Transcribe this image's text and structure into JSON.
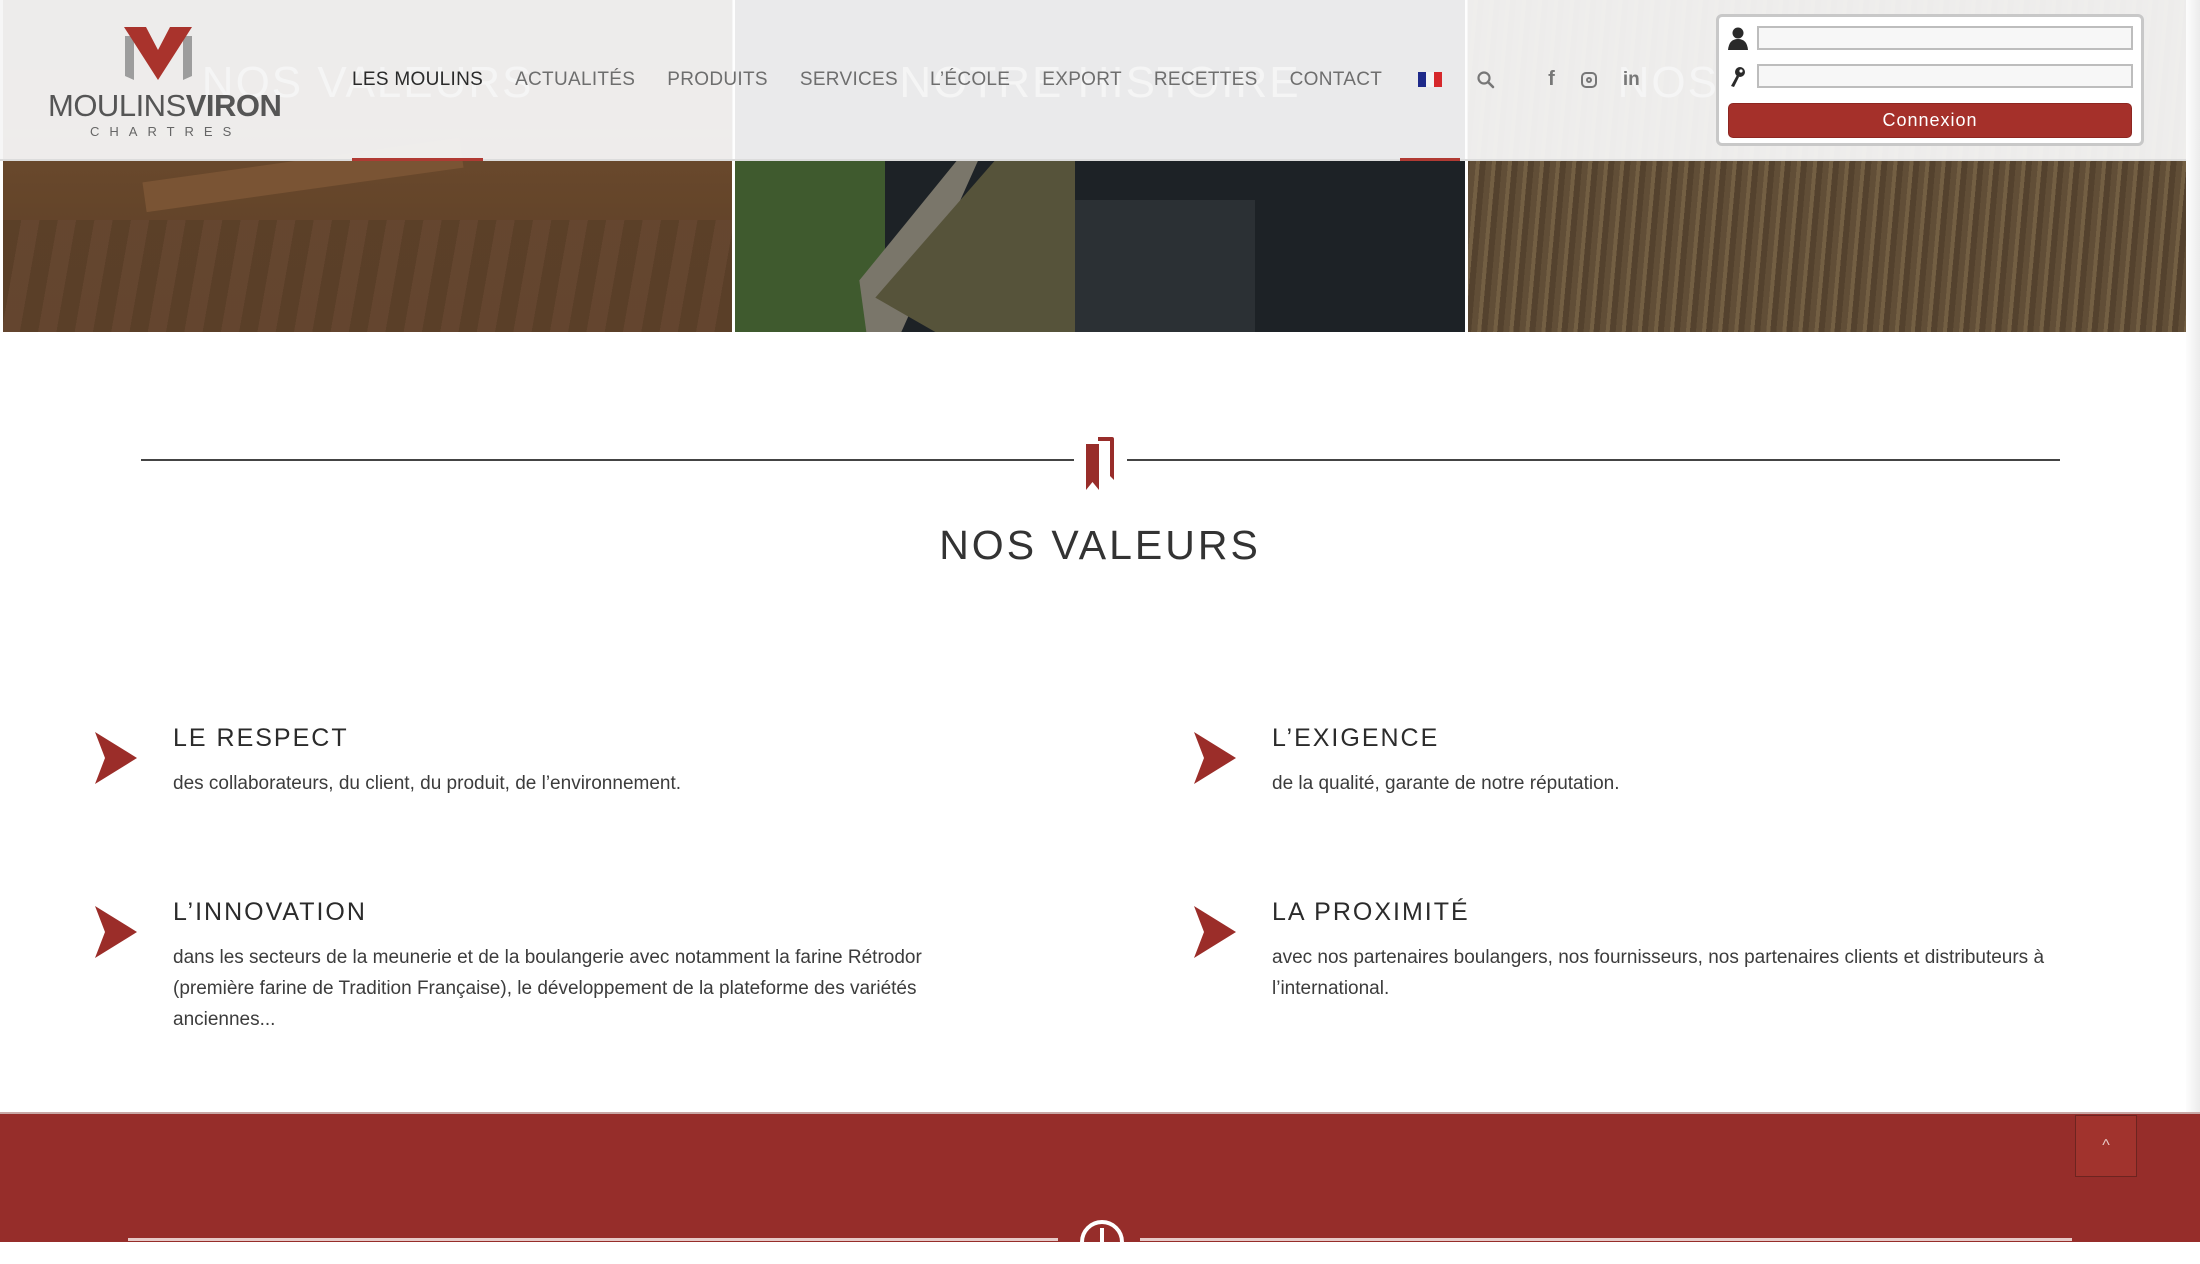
{
  "brand": {
    "logo_main": "MOULINS",
    "logo_bold": "VIRON",
    "logo_sub": "CHARTRES",
    "accent_color": "#962d2a",
    "logo_red": "#a9332c",
    "logo_grey": "#9a9a9a"
  },
  "nav": {
    "items": [
      {
        "label": "LES MOULINS",
        "active": true
      },
      {
        "label": "ACTUALITÉS",
        "active": false
      },
      {
        "label": "PRODUITS",
        "active": false
      },
      {
        "label": "SERVICES",
        "active": false
      },
      {
        "label": "L’ÉCOLE",
        "active": false
      },
      {
        "label": "EXPORT",
        "active": false
      },
      {
        "label": "RECETTES",
        "active": false
      },
      {
        "label": "CONTACT",
        "active": false
      }
    ],
    "language": "fr-flag-icon",
    "search_icon": "search-icon",
    "social": [
      "facebook-icon",
      "instagram-icon",
      "linkedin-icon"
    ],
    "social_labels": {
      "facebook": "f",
      "linkedin": "in"
    }
  },
  "panels": [
    {
      "title": "NOS VALEURS",
      "image": "mill-floor-photo"
    },
    {
      "title": "NOTRE HISTOIRE",
      "image": "aerial-mill-photo"
    },
    {
      "title": "NOS ...",
      "image": "wheat-field-photo"
    }
  ],
  "login": {
    "username_value": "",
    "password_value": "",
    "button_label": "Connexion",
    "user_icon": "user-icon",
    "key_icon": "key-icon"
  },
  "section": {
    "icon": "bookmark-icon",
    "title": "NOS VALEURS"
  },
  "values": [
    {
      "title": "LE RESPECT",
      "text": "des collaborateurs, du client, du produit, de l’environnement."
    },
    {
      "title": "L’EXIGENCE",
      "text": "de la qualité, garante de notre réputation."
    },
    {
      "title": "L’INNOVATION",
      "text": "dans les secteurs de la meunerie et de la boulangerie avec notamment  la farine Rétrodor (première farine de Tradition Française), le développement de  la plateforme des variétés anciennes..."
    },
    {
      "title": "LA PROXIMITÉ",
      "text": "avec nos partenaires boulangers, nos fournisseurs, nos partenaires clients et distributeurs à l’international."
    }
  ],
  "scroll_top": {
    "label": "^"
  }
}
